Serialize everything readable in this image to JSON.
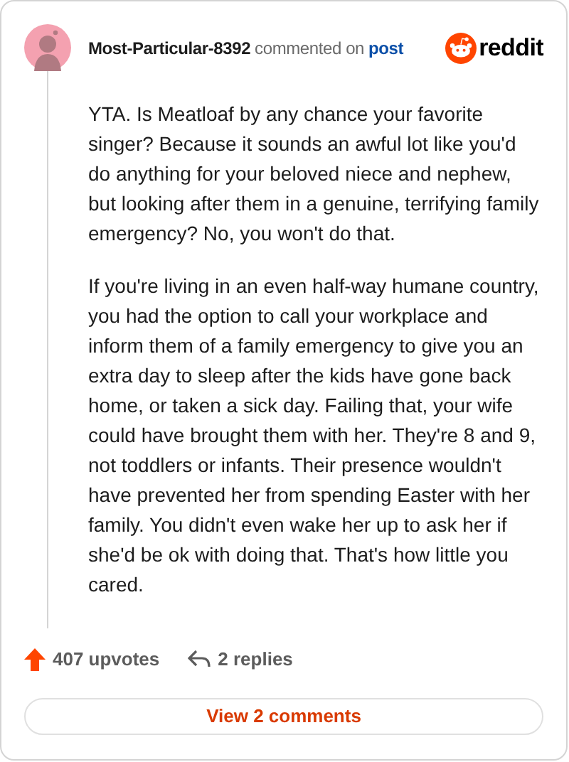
{
  "comment": {
    "author": "Most-Particular-8392",
    "action": "commented on",
    "link": "post",
    "brand": "reddit",
    "paragraphs": [
      "YTA. Is Meatloaf by any chance your favorite singer? Because it sounds an awful lot like you'd do anything for your beloved niece and nephew, but looking after them in a genuine, terrifying family emergency? No, you won't do that.",
      "If you're living in an even half-way humane country, you had the option to call your workplace and inform them of a family emergency to give you an extra day to sleep after the kids have gone back home, or taken a sick day. Failing that, your wife could have brought them with her. They're 8 and 9, not toddlers or infants. Their presence wouldn't have prevented her from spending Easter with her family. You didn't even wake her up to ask her if she'd be ok with doing that. That's how little you cared."
    ]
  },
  "footer": {
    "upvotes": "407 upvotes",
    "replies": "2 replies",
    "view_button": "View 2 comments"
  }
}
